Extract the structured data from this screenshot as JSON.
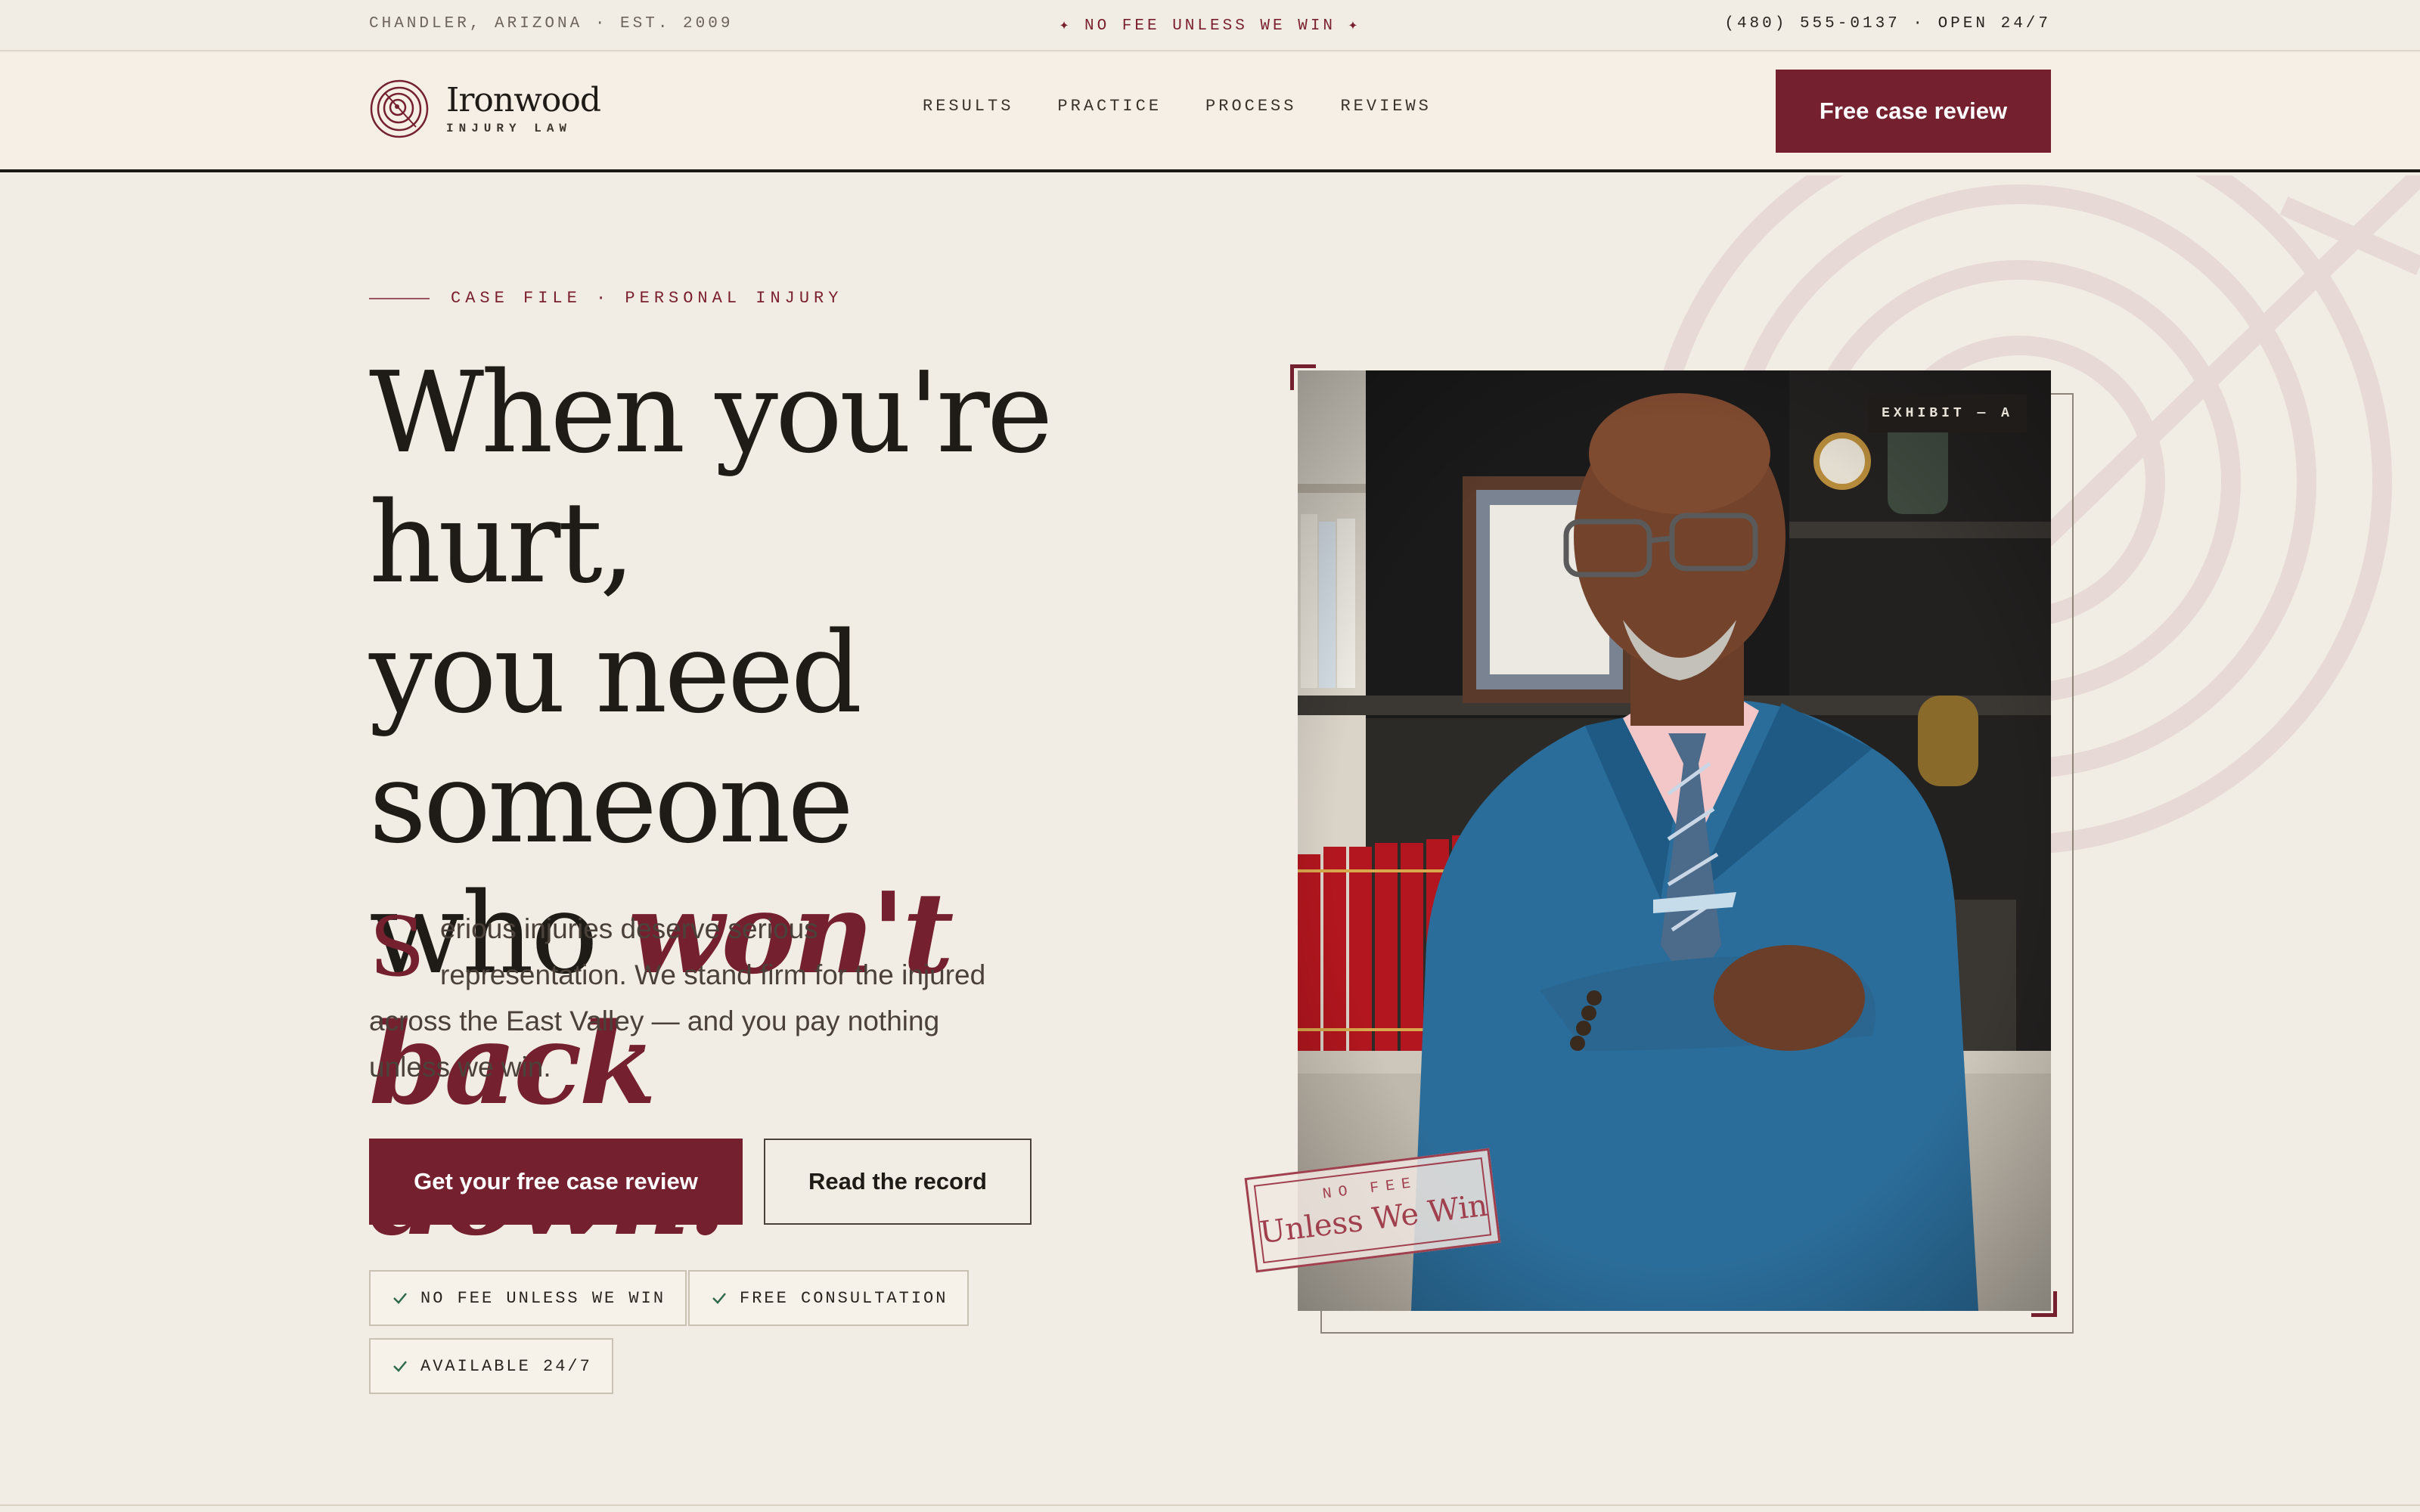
{
  "topbar": {
    "location": "CHANDLER, ARIZONA · EST. 2009",
    "tagline": "✦ NO FEE UNLESS WE WIN ✦",
    "contact": "(480) 555-0137 · OPEN 24/7"
  },
  "header": {
    "brand_name": "Ironwood",
    "brand_sub": "INJURY LAW",
    "nav": [
      "RESULTS",
      "PRACTICE",
      "PROCESS",
      "REVIEWS"
    ],
    "cta_label": "Free case review"
  },
  "hero": {
    "eyebrow": "CASE FILE · PERSONAL INJURY",
    "headline_line1": "When you're hurt,",
    "headline_line2": "you need someone",
    "headline_line3_plain": "who ",
    "headline_line3_accent": "won't back",
    "headline_line4_accent": "down.",
    "dropcap": "S",
    "lede": "erious injuries deserve serious representation. We stand firm for the injured across the East Valley — and you pay nothing unless we win.",
    "primary_cta": "Get your free case review",
    "secondary_cta": "Read the record",
    "chips": [
      "NO FEE UNLESS WE WIN",
      "FREE CONSULTATION",
      "AVAILABLE 24/7"
    ]
  },
  "photo": {
    "exhibit_label": "EXHIBIT — A",
    "stamp_top": "NO FEE",
    "stamp_main": "Unless We Win"
  },
  "colors": {
    "accent": "#74202f",
    "background": "#f2ede4",
    "ink": "#1f1b17"
  }
}
